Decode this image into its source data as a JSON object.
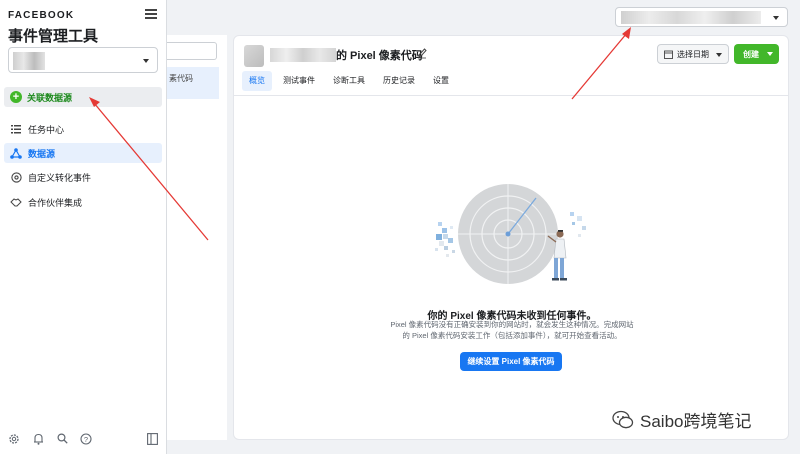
{
  "sidebar": {
    "brand": "FACEBOOK",
    "app_title": "事件管理工具",
    "connect_label": "关联数据源",
    "nav": [
      {
        "label": "任务中心",
        "icon": "list-icon"
      },
      {
        "label": "数据源",
        "icon": "data-sources-icon",
        "active": true
      },
      {
        "label": "自定义转化事件",
        "icon": "custom-conversion-icon"
      },
      {
        "label": "合作伙伴集成",
        "icon": "handshake-icon"
      }
    ],
    "footer_icons": [
      "settings-icon",
      "notifications-icon",
      "search-icon",
      "help-icon",
      "panel-icon"
    ]
  },
  "list": {
    "item_label": "素代码"
  },
  "main": {
    "pixel_title": "的 Pixel 像素代码",
    "date_label": "选择日期",
    "create_label": "创建",
    "tabs": [
      "概览",
      "测试事件",
      "诊断工具",
      "历史记录",
      "设置"
    ],
    "active_tab": 0,
    "empty_title": "你的 Pixel 像素代码未收到任何事件。",
    "empty_desc_1": "Pixel 像素代码没有正确安装到你的网站时，就会发生这种情况。完成网站",
    "empty_desc_2": "的 Pixel 像素代码安装工作（包括添加事件），就可开始查看活动。",
    "setup_button": "继续设置 Pixel 像素代码"
  },
  "watermark": "Saibo跨境笔记",
  "colors": {
    "accent_blue": "#1877f2",
    "create_green": "#42b72a",
    "annotation_red": "#e53935"
  }
}
